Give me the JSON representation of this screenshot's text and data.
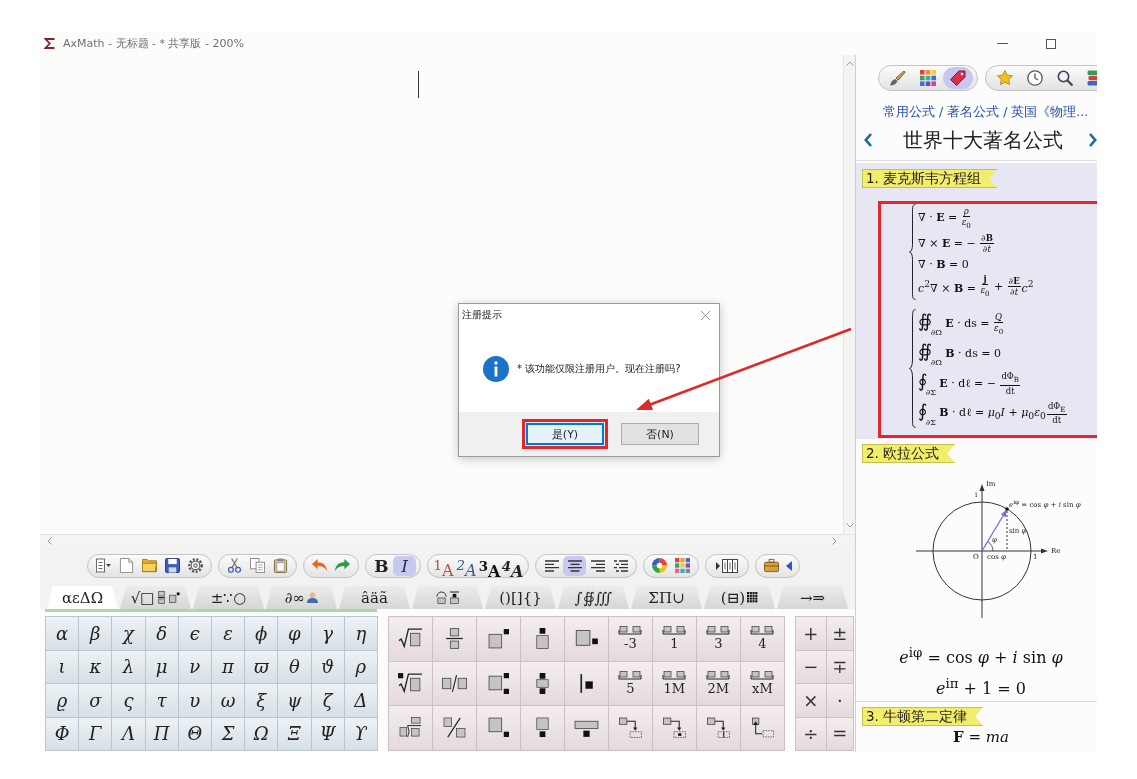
{
  "window": {
    "title": "AxMath - 无标题 - * 共享版 - 200%"
  },
  "toolbar": {
    "style_buttons": [
      {
        "label": "B",
        "selected": false
      },
      {
        "label": "I",
        "selected": true
      }
    ],
    "size_buttons": [
      "$^{1}$A",
      "$^{2}$A",
      "$^{3}$A",
      "$^{4}$A"
    ],
    "align_buttons": [
      {
        "selected": false
      },
      {
        "selected": true
      },
      {
        "selected": false
      },
      {
        "selected": false
      }
    ]
  },
  "symbol_tabs": [
    {
      "label": "αεΔΩ",
      "selected": true
    },
    {
      "label": "√□",
      "selected": false
    },
    {
      "label": "±∵○",
      "selected": false
    },
    {
      "label": "∂∞",
      "selected": false
    },
    {
      "label": "âäã",
      "selected": false
    },
    {
      "selected": false
    },
    {
      "label": "()[]{}",
      "selected": false
    },
    {
      "label": "∫∯∭",
      "selected": false
    },
    {
      "label": "ΣΠ∪",
      "selected": false
    },
    {
      "label": "(⊟)",
      "selected": false
    },
    {
      "label": "→⇒",
      "selected": false
    }
  ],
  "greek": [
    [
      "α",
      "β",
      "χ",
      "δ",
      "ϵ",
      "ε",
      "ϕ",
      "φ",
      "γ",
      "η"
    ],
    [
      "ι",
      "κ",
      "λ",
      "μ",
      "ν",
      "π",
      "ϖ",
      "θ",
      "ϑ",
      "ρ"
    ],
    [
      "ϱ",
      "σ",
      "ς",
      "τ",
      "υ",
      "ω",
      "ξ",
      "ψ",
      "ζ",
      "Δ"
    ],
    [
      "Φ",
      "Γ",
      "Λ",
      "Π",
      "Θ",
      "Σ",
      "Ω",
      "Ξ",
      "Ψ",
      "ϒ"
    ]
  ],
  "script_templates": [
    "-3",
    "1",
    "3",
    "4",
    "5",
    "1M",
    "2M",
    "xM"
  ],
  "operators": [
    [
      "+",
      "±"
    ],
    [
      "−",
      "∓"
    ],
    [
      "×",
      "·"
    ],
    [
      "÷",
      "="
    ]
  ],
  "dialog": {
    "title": "注册提示",
    "message": "* 该功能仅限注册用户。现在注册吗?",
    "buttons": [
      {
        "label": "是(Y)",
        "focused": true,
        "highlighted": true
      },
      {
        "label": "否(N)",
        "focused": false,
        "highlighted": false
      }
    ]
  },
  "panel": {
    "tabs": [
      {
        "selected": false
      },
      {
        "selected": false
      },
      {
        "selected": true
      }
    ],
    "breadcrumb": "常用公式 / 著名公式 / 英国《物理...",
    "title": "世界十大著名公式",
    "sections": [
      {
        "tag": "1. 麦克斯韦方程组",
        "selected": true,
        "highlighted": true,
        "systems": [
          [
            [
              "∇ · **E** = ",
              {
                "num": "*ρ*",
                "den": "*ε*$_{0}$"
              }
            ],
            [
              "∇ × **E** = − ",
              {
                "num": "∂**B**",
                "den": "∂*t*"
              }
            ],
            [
              "∇ · **B** = 0"
            ],
            [
              "*c*$^{2}$∇ × **B** = ",
              {
                "num": "**j**",
                "den": "*ε*$_{0}$"
              },
              " + ",
              {
                "num": "∂**E**",
                "den": "∂*t*"
              },
              "*c*$^{2}$"
            ]
          ],
          [
            [
              {
                "op": "∯",
                "sub": "∂Ω"
              },
              " **E** · ds = ",
              {
                "num": "*Q*",
                "den": "*ε*$_{0}$"
              }
            ],
            [
              {
                "op": "∯",
                "sub": "∂Ω"
              },
              " **B** · ds = 0"
            ],
            [
              {
                "op": "∮",
                "sub": "∂Σ"
              },
              " **E** · dℓ = − ",
              {
                "num": "dΦ$_{B}$",
                "den": "dt"
              }
            ],
            [
              {
                "op": "∮",
                "sub": "∂Σ"
              },
              " **B** · dℓ = *μ*$_{0}$*I* + *μ*$_{0}$*ε*$_{0}$",
              {
                "num": "dΦ$_{E}$",
                "den": "dt"
              }
            ]
          ]
        ]
      },
      {
        "tag": "2. 欧拉公式",
        "selected": false,
        "diagram": {
          "labels": {
            "im": "Im",
            "i": "i",
            "point": "*e*$^{iφ}$ = cos *φ* + *i* sin *φ*",
            "sin": "sin *φ*",
            "angle": "*φ*",
            "origin": "O",
            "cos": "cos *φ*",
            "unit": "1",
            "re": "Re"
          }
        },
        "formulas": [
          "*e*$^{iφ}$ = cos *φ* + *i* sin *φ*",
          "*e*$^{iπ}$ + 1 = 0"
        ]
      },
      {
        "tag": "3. 牛顿第二定律",
        "selected": false,
        "formulas": [
          "**F** = *ma*"
        ]
      }
    ]
  }
}
